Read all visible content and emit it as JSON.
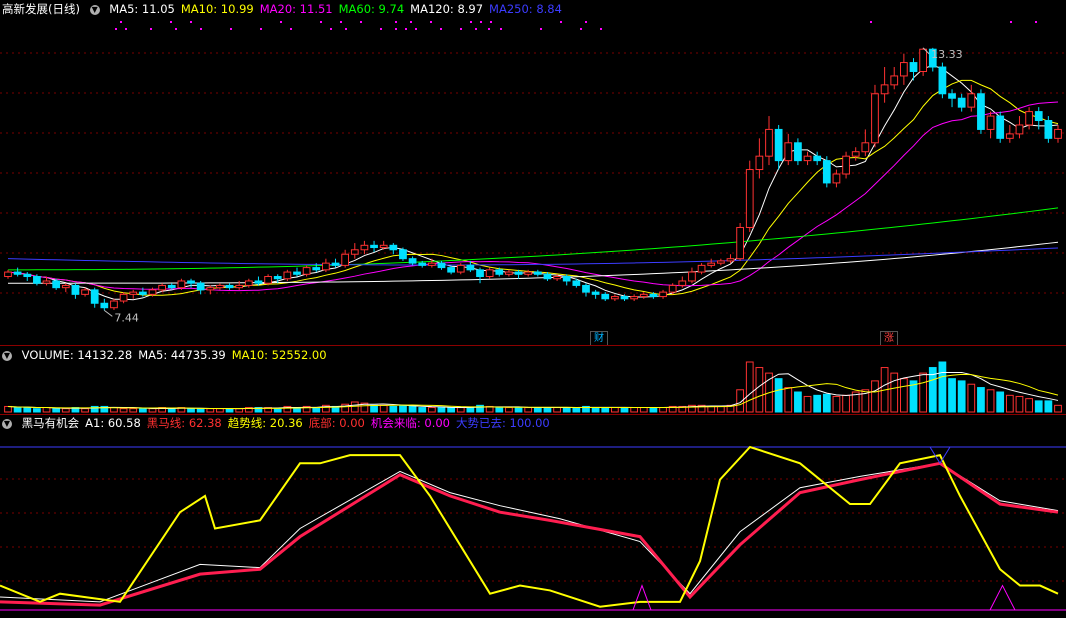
{
  "price_panel": {
    "title": "高新发展(日线)",
    "ma_legend": [
      {
        "label": "MA5: 11.05",
        "color": "#ffffff"
      },
      {
        "label": "MA10: 10.99",
        "color": "#ffff00"
      },
      {
        "label": "MA20: 11.51",
        "color": "#ff00ff"
      },
      {
        "label": "MA60: 9.74",
        "color": "#00ff00"
      },
      {
        "label": "MA120: 8.97",
        "color": "#ffffff"
      },
      {
        "label": "MA250: 8.84",
        "color": "#3c3cff"
      }
    ],
    "high_label": "13.33",
    "low_label": "7.44",
    "event_tags": [
      {
        "text": "财",
        "color": "#00b4ff"
      },
      {
        "text": "涨",
        "color": "#ff4040"
      }
    ]
  },
  "volume_panel": {
    "legend": [
      {
        "label": "VOLUME: 14132.28",
        "color": "#ffffff"
      },
      {
        "label": "MA5: 44735.39",
        "color": "#ffffff"
      },
      {
        "label": "MA10: 52552.00",
        "color": "#ffff00"
      }
    ]
  },
  "indicator_panel": {
    "legend": [
      {
        "label": "黑马有机会",
        "color": "#ffffff"
      },
      {
        "label": "A1: 60.58",
        "color": "#ffffff"
      },
      {
        "label": "黑马线: 62.38",
        "color": "#ff3030"
      },
      {
        "label": "趋势线: 20.36",
        "color": "#ffff00"
      },
      {
        "label": "底部: 0.00",
        "color": "#ff3030"
      },
      {
        "label": "机会来临: 0.00",
        "color": "#ff00ff"
      },
      {
        "label": "大势已去: 100.00",
        "color": "#3c3cff"
      }
    ]
  },
  "chart_data": {
    "type": "candlestick",
    "price_axis_range": [
      7.0,
      14.0
    ],
    "high": 13.33,
    "low": 7.44,
    "candles": [
      [
        8.2,
        8.3,
        8.15,
        8.35
      ],
      [
        8.3,
        8.25,
        8.2,
        8.4
      ],
      [
        8.25,
        8.2,
        8.1,
        8.3
      ],
      [
        8.2,
        8.05,
        8.0,
        8.25
      ],
      [
        8.05,
        8.1,
        8.0,
        8.2
      ],
      [
        8.1,
        7.95,
        7.9,
        8.15
      ],
      [
        7.95,
        8.0,
        7.85,
        8.05
      ],
      [
        8.0,
        7.8,
        7.7,
        8.05
      ],
      [
        7.8,
        7.9,
        7.75,
        7.95
      ],
      [
        7.9,
        7.6,
        7.5,
        7.95
      ],
      [
        7.6,
        7.5,
        7.44,
        7.7
      ],
      [
        7.5,
        7.65,
        7.45,
        7.7
      ],
      [
        7.65,
        7.8,
        7.6,
        7.85
      ],
      [
        7.8,
        7.85,
        7.7,
        7.9
      ],
      [
        7.85,
        7.8,
        7.75,
        7.95
      ],
      [
        7.8,
        7.9,
        7.75,
        7.95
      ],
      [
        7.9,
        8.0,
        7.85,
        8.05
      ],
      [
        8.0,
        7.95,
        7.9,
        8.05
      ],
      [
        7.95,
        8.1,
        7.9,
        8.15
      ],
      [
        8.1,
        8.05,
        7.95,
        8.15
      ],
      [
        8.05,
        7.9,
        7.8,
        8.1
      ],
      [
        7.9,
        7.95,
        7.8,
        8.0
      ],
      [
        7.95,
        8.0,
        7.9,
        8.05
      ],
      [
        8.0,
        7.95,
        7.9,
        8.05
      ],
      [
        7.95,
        8.0,
        7.9,
        8.1
      ],
      [
        8.0,
        8.1,
        7.95,
        8.15
      ],
      [
        8.1,
        8.05,
        8.0,
        8.2
      ],
      [
        8.05,
        8.2,
        8.0,
        8.25
      ],
      [
        8.2,
        8.15,
        8.05,
        8.25
      ],
      [
        8.15,
        8.3,
        8.1,
        8.35
      ],
      [
        8.3,
        8.25,
        8.2,
        8.4
      ],
      [
        8.25,
        8.4,
        8.2,
        8.45
      ],
      [
        8.4,
        8.35,
        8.3,
        8.5
      ],
      [
        8.35,
        8.5,
        8.3,
        8.6
      ],
      [
        8.5,
        8.45,
        8.4,
        8.6
      ],
      [
        8.45,
        8.7,
        8.4,
        8.8
      ],
      [
        8.7,
        8.8,
        8.6,
        8.95
      ],
      [
        8.8,
        8.9,
        8.7,
        9.0
      ],
      [
        8.9,
        8.85,
        8.75,
        9.0
      ],
      [
        8.85,
        8.9,
        8.8,
        9.0
      ],
      [
        8.9,
        8.8,
        8.7,
        8.95
      ],
      [
        8.8,
        8.6,
        8.55,
        8.85
      ],
      [
        8.6,
        8.5,
        8.45,
        8.65
      ],
      [
        8.5,
        8.45,
        8.4,
        8.55
      ],
      [
        8.45,
        8.5,
        8.4,
        8.6
      ],
      [
        8.5,
        8.4,
        8.35,
        8.55
      ],
      [
        8.4,
        8.3,
        8.25,
        8.45
      ],
      [
        8.3,
        8.45,
        8.25,
        8.5
      ],
      [
        8.45,
        8.35,
        8.3,
        8.55
      ],
      [
        8.35,
        8.2,
        8.05,
        8.4
      ],
      [
        8.2,
        8.35,
        8.15,
        8.4
      ],
      [
        8.35,
        8.25,
        8.2,
        8.4
      ],
      [
        8.25,
        8.3,
        8.2,
        8.35
      ],
      [
        8.3,
        8.25,
        8.15,
        8.35
      ],
      [
        8.25,
        8.3,
        8.2,
        8.35
      ],
      [
        8.3,
        8.25,
        8.2,
        8.35
      ],
      [
        8.25,
        8.15,
        8.1,
        8.3
      ],
      [
        8.15,
        8.2,
        8.1,
        8.25
      ],
      [
        8.2,
        8.1,
        8.0,
        8.25
      ],
      [
        8.1,
        8.0,
        7.95,
        8.15
      ],
      [
        8.0,
        7.85,
        7.75,
        8.05
      ],
      [
        7.85,
        7.8,
        7.7,
        7.9
      ],
      [
        7.8,
        7.7,
        7.65,
        7.85
      ],
      [
        7.7,
        7.75,
        7.65,
        7.8
      ],
      [
        7.75,
        7.7,
        7.65,
        7.8
      ],
      [
        7.7,
        7.75,
        7.65,
        7.8
      ],
      [
        7.75,
        7.8,
        7.7,
        7.85
      ],
      [
        7.8,
        7.75,
        7.7,
        7.85
      ],
      [
        7.75,
        7.85,
        7.7,
        7.9
      ],
      [
        7.85,
        8.0,
        7.8,
        8.05
      ],
      [
        8.0,
        8.1,
        7.95,
        8.2
      ],
      [
        8.1,
        8.3,
        8.05,
        8.4
      ],
      [
        8.3,
        8.45,
        8.25,
        8.5
      ],
      [
        8.45,
        8.5,
        8.4,
        8.6
      ],
      [
        8.5,
        8.55,
        8.45,
        8.6
      ],
      [
        8.55,
        8.6,
        8.5,
        8.7
      ],
      [
        8.6,
        9.3,
        8.55,
        9.4
      ],
      [
        9.3,
        10.6,
        9.2,
        10.8
      ],
      [
        10.6,
        10.9,
        10.4,
        11.3
      ],
      [
        10.9,
        11.5,
        10.7,
        11.8
      ],
      [
        11.5,
        10.8,
        10.6,
        11.6
      ],
      [
        10.8,
        11.2,
        10.7,
        11.4
      ],
      [
        11.2,
        10.8,
        10.7,
        11.3
      ],
      [
        10.8,
        10.9,
        10.7,
        11.0
      ],
      [
        10.9,
        10.8,
        10.7,
        11.0
      ],
      [
        10.8,
        10.3,
        10.2,
        10.9
      ],
      [
        10.3,
        10.5,
        10.2,
        10.6
      ],
      [
        10.5,
        10.9,
        10.4,
        11.0
      ],
      [
        10.9,
        11.0,
        10.8,
        11.1
      ],
      [
        11.0,
        11.2,
        10.9,
        11.5
      ],
      [
        11.2,
        12.3,
        11.1,
        12.5
      ],
      [
        12.3,
        12.5,
        12.1,
        12.9
      ],
      [
        12.5,
        12.7,
        12.4,
        12.9
      ],
      [
        12.7,
        13.0,
        12.5,
        13.2
      ],
      [
        13.0,
        12.8,
        12.6,
        13.1
      ],
      [
        12.8,
        13.3,
        12.7,
        13.33
      ],
      [
        13.3,
        12.9,
        12.8,
        13.33
      ],
      [
        12.9,
        12.3,
        12.2,
        13.0
      ],
      [
        12.3,
        12.2,
        12.0,
        12.4
      ],
      [
        12.2,
        12.0,
        11.9,
        12.3
      ],
      [
        12.0,
        12.3,
        11.9,
        12.5
      ],
      [
        12.3,
        11.5,
        11.4,
        12.4
      ],
      [
        11.5,
        11.8,
        11.3,
        11.9
      ],
      [
        11.8,
        11.3,
        11.2,
        11.9
      ],
      [
        11.3,
        11.4,
        11.2,
        11.6
      ],
      [
        11.4,
        11.6,
        11.3,
        11.8
      ],
      [
        11.6,
        11.9,
        11.5,
        12.0
      ],
      [
        11.9,
        11.7,
        11.5,
        12.0
      ],
      [
        11.7,
        11.3,
        11.2,
        11.8
      ],
      [
        11.3,
        11.5,
        11.2,
        11.6
      ]
    ],
    "volume": [
      5,
      4,
      4,
      3,
      4,
      3,
      3,
      4,
      3,
      5,
      5,
      4,
      3,
      3,
      3,
      3,
      4,
      3,
      4,
      3,
      3,
      3,
      3,
      3,
      3,
      4,
      4,
      4,
      3,
      5,
      4,
      5,
      4,
      6,
      5,
      7,
      9,
      8,
      6,
      6,
      5,
      6,
      5,
      4,
      4,
      4,
      4,
      4,
      4,
      6,
      5,
      4,
      4,
      4,
      4,
      4,
      4,
      4,
      4,
      4,
      5,
      4,
      4,
      4,
      4,
      4,
      4,
      4,
      4,
      5,
      5,
      6,
      6,
      5,
      5,
      6,
      20,
      45,
      40,
      35,
      30,
      22,
      18,
      14,
      15,
      16,
      14,
      15,
      18,
      20,
      28,
      40,
      35,
      30,
      28,
      35,
      40,
      45,
      30,
      28,
      25,
      22,
      20,
      18,
      15,
      14,
      12,
      10,
      10,
      6
    ],
    "indicator_series": [
      {
        "name": "黑马线",
        "color": "#ff3030"
      },
      {
        "name": "趋势线",
        "color": "#ffff00"
      },
      {
        "name": "A1",
        "color": "#ffffff"
      },
      {
        "name": "大势已去",
        "color": "#3c3cff"
      },
      {
        "name": "机会来临",
        "color": "#ff00ff"
      }
    ]
  }
}
